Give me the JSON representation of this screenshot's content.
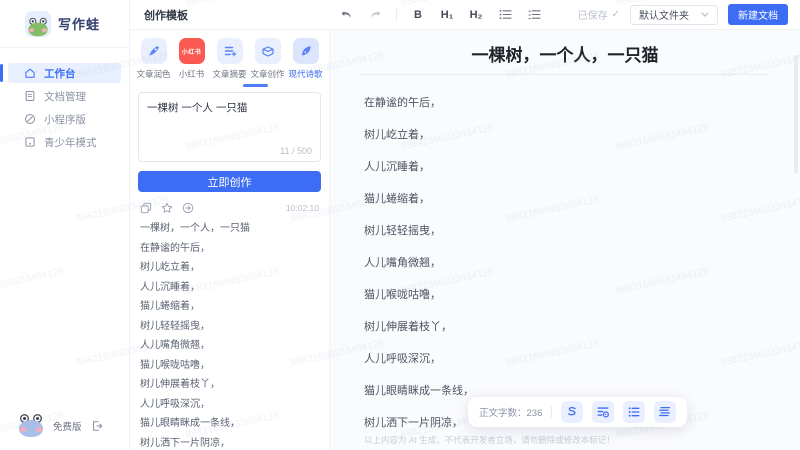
{
  "colors": {
    "accent": "#3D6DF5",
    "xiaohongshu_red": "#FA5A50",
    "active_item_bg": "#E8EFFF"
  },
  "watermark": "88821696933484128",
  "app": {
    "logo_text": "写作蛙",
    "plan_label": "免费版"
  },
  "sidebar": {
    "items": [
      {
        "label": "工作台"
      },
      {
        "label": "文档管理"
      },
      {
        "label": "小程序版"
      },
      {
        "label": "青少年模式"
      }
    ]
  },
  "topbar": {
    "title": "创作模板",
    "bold": "B",
    "h1": "H₁",
    "h2": "H₂",
    "save_status": "已保存",
    "check": "✓",
    "folder_value": "默认文件夹",
    "new_doc_label": "新建文档"
  },
  "templates": {
    "xhs_badge": "小红书",
    "tabs": [
      {
        "label": "文章润色"
      },
      {
        "label": "小红书"
      },
      {
        "label": "文章摘要"
      },
      {
        "label": "文章创作"
      },
      {
        "label": "现代诗歌"
      }
    ]
  },
  "composer": {
    "value": "一棵树 一个人 一只猫",
    "counter": "11 / 500",
    "submit_label": "立即创作"
  },
  "result": {
    "timestamp": "10:02:10",
    "lines": [
      "一棵树，一个人，一只猫",
      "在静谧的午后，",
      "树儿屹立着，",
      "人儿沉睡着，",
      "猫儿蜷缩着，",
      "树儿轻轻摇曳，",
      "人儿嘴角微翘，",
      "猫儿喉咙咕噜，",
      "树儿伸展着枝丫，",
      "人儿呼吸深沉，",
      "猫儿眼睛眯成一条线，",
      "树儿洒下一片阴凉，"
    ]
  },
  "editor": {
    "title": "一棵树，一个人，一只猫",
    "lines": [
      "在静谧的午后，",
      "树儿屹立着，",
      "人儿沉睡着，",
      "猫儿蜷缩着，",
      "树儿轻轻摇曳，",
      "人儿嘴角微翘，",
      "猫儿喉咙咕噜，",
      "树儿伸展着枝丫，",
      "人儿呼吸深沉，",
      "猫儿眼睛眯成一条线，",
      "树儿洒下一片阴凉，"
    ],
    "word_count": "正文字数：236",
    "disclaimer": "以上内容为 AI 生成，不代表开发者立场，请勿删除或修改本标记！"
  }
}
